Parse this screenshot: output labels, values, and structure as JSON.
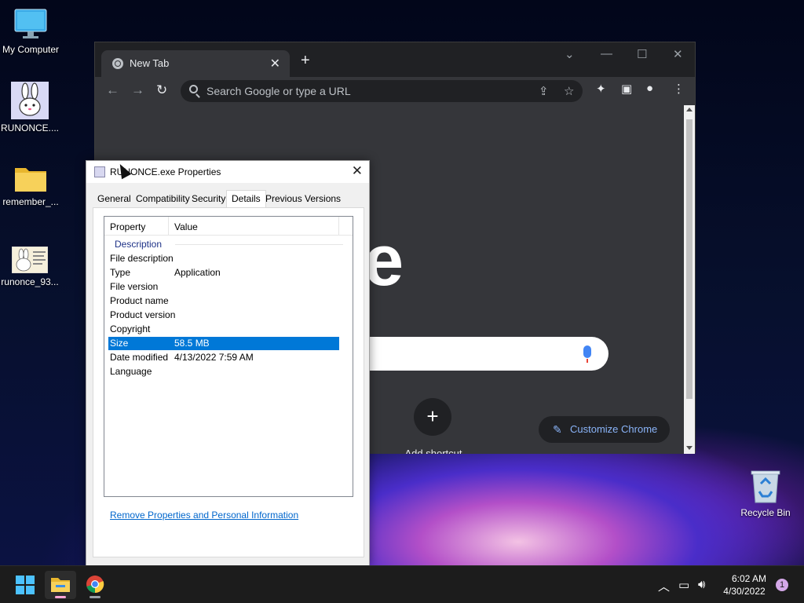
{
  "desktop": {
    "icons": [
      {
        "label": "My Computer",
        "icon": "monitor-icon"
      },
      {
        "label": "RUNONCE....",
        "icon": "bunny-app-icon"
      },
      {
        "label": "remember_...",
        "icon": "folder-icon"
      },
      {
        "label": "runonce_93...",
        "icon": "image-file-icon"
      },
      {
        "label": "Recycle Bin",
        "icon": "recycle-bin-icon"
      }
    ]
  },
  "chrome": {
    "tab_title": "New Tab",
    "tab_close": "✕",
    "new_tab": "+",
    "omnibox_placeholder": "Search Google or type a URL",
    "logo_text": "ogle",
    "add_shortcut_symbol": "+",
    "add_shortcut_label": "Add shortcut",
    "customize_label": "Customize Chrome"
  },
  "dialog": {
    "title": "RUNONCE.exe Properties",
    "close": "✕",
    "tabs": [
      "General",
      "Compatibility",
      "Security",
      "Details",
      "Previous Versions"
    ],
    "active_tab": "Details",
    "columns": [
      "Property",
      "Value"
    ],
    "group": "Description",
    "rows": [
      {
        "property": "File description",
        "value": ""
      },
      {
        "property": "Type",
        "value": "Application"
      },
      {
        "property": "File version",
        "value": ""
      },
      {
        "property": "Product name",
        "value": ""
      },
      {
        "property": "Product version",
        "value": ""
      },
      {
        "property": "Copyright",
        "value": ""
      },
      {
        "property": "Size",
        "value": "58.5 MB"
      },
      {
        "property": "Date modified",
        "value": "4/13/2022 7:59 AM"
      },
      {
        "property": "Language",
        "value": ""
      }
    ],
    "selected_row": "Size",
    "remove_link": "Remove Properties and Personal Information"
  },
  "taskbar": {
    "time": "6:02 AM",
    "date": "4/30/2022",
    "notification_count": "1"
  },
  "colors": {
    "chrome_dark": "#202124",
    "chrome_toolbar": "#35363a",
    "selection_blue": "#0078d7",
    "link_blue": "#0066cc",
    "accent_blue": "#8ab4f8"
  }
}
